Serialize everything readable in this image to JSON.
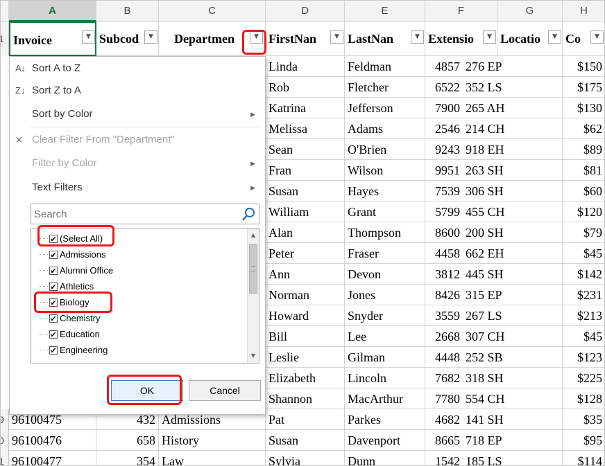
{
  "columns": [
    "A",
    "B",
    "C",
    "D",
    "E",
    "F",
    "G",
    "H"
  ],
  "header_row_number": "1",
  "headers": [
    "Invoice",
    "Subcod",
    "Departmen",
    "FirstNan",
    "LastNan",
    "Extensio",
    "Locatio",
    "Co"
  ],
  "rows": [
    {
      "first": "Linda",
      "last": "Feldman",
      "ext": "4857",
      "loc": "276 EP",
      "cost": "$150"
    },
    {
      "first": "Rob",
      "last": "Fletcher",
      "ext": "6522",
      "loc": "352 LS",
      "cost": "$175"
    },
    {
      "first": "Katrina",
      "last": "Jefferson",
      "ext": "7900",
      "loc": "265 AH",
      "cost": "$130"
    },
    {
      "first": "Melissa",
      "last": "Adams",
      "ext": "2546",
      "loc": "214 CH",
      "cost": "$62"
    },
    {
      "first": "Sean",
      "last": "O'Brien",
      "ext": "9243",
      "loc": "918 EH",
      "cost": "$89"
    },
    {
      "first": "Fran",
      "last": "Wilson",
      "ext": "9951",
      "loc": "263 SH",
      "cost": "$81"
    },
    {
      "first": "Susan",
      "last": "Hayes",
      "ext": "7539",
      "loc": "306 SH",
      "cost": "$60"
    },
    {
      "first": "William",
      "last": "Grant",
      "ext": "5799",
      "loc": "455 CH",
      "cost": "$120"
    },
    {
      "first": "Alan",
      "last": "Thompson",
      "ext": "8600",
      "loc": "200 SH",
      "cost": "$79"
    },
    {
      "first": "Peter",
      "last": "Fraser",
      "ext": "4458",
      "loc": "662 EH",
      "cost": "$45"
    },
    {
      "first": "Ann",
      "last": "Devon",
      "ext": "3812",
      "loc": "445 SH",
      "cost": "$142"
    },
    {
      "first": "Norman",
      "last": "Jones",
      "ext": "8426",
      "loc": "315 EP",
      "cost": "$231"
    },
    {
      "first": "Howard",
      "last": "Snyder",
      "ext": "3559",
      "loc": "267 LS",
      "cost": "$213"
    },
    {
      "first": "Bill",
      "last": "Lee",
      "ext": "2668",
      "loc": "307 CH",
      "cost": "$45"
    },
    {
      "first": "Leslie",
      "last": "Gilman",
      "ext": "4448",
      "loc": "252 SB",
      "cost": "$123"
    },
    {
      "first": "Elizabeth",
      "last": "Lincoln",
      "ext": "7682",
      "loc": "318 SH",
      "cost": "$225"
    },
    {
      "first": "Shannon",
      "last": "MacArthur",
      "ext": "7780",
      "loc": "554 CH",
      "cost": "$128"
    },
    {
      "rownum": "9",
      "invoice": "96100475",
      "subcode": "432",
      "dept": "Admissions",
      "first": "Pat",
      "last": "Parkes",
      "ext": "4682",
      "loc": "141 SH",
      "cost": "$35"
    },
    {
      "rownum": "0",
      "invoice": "96100476",
      "subcode": "658",
      "dept": "History",
      "first": "Susan",
      "last": "Davenport",
      "ext": "8665",
      "loc": "718 EP",
      "cost": "$95"
    },
    {
      "rownum": "1",
      "invoice": "96100477",
      "subcode": "354",
      "dept": "Law",
      "first": "Sylvia",
      "last": "Dunn",
      "ext": "1542",
      "loc": "185 LS",
      "cost": "$114"
    }
  ],
  "filter_menu": {
    "sort_az": "Sort A to Z",
    "sort_za": "Sort Z to A",
    "sort_by_color": "Sort by Color",
    "clear_filter": "Clear Filter From \"Department\"",
    "filter_by_color": "Filter by Color",
    "text_filters": "Text Filters",
    "search_placeholder": "Search",
    "items": [
      {
        "label": "(Select All)",
        "checked": true
      },
      {
        "label": "Admissions",
        "checked": true
      },
      {
        "label": "Alumni Office",
        "checked": true
      },
      {
        "label": "Athletics",
        "checked": true
      },
      {
        "label": "Biology",
        "checked": true
      },
      {
        "label": "Chemistry",
        "checked": true
      },
      {
        "label": "Education",
        "checked": true
      },
      {
        "label": "Engineering",
        "checked": true
      }
    ],
    "ok_label": "OK",
    "cancel_label": "Cancel"
  },
  "colors": {
    "highlight": "#e8181c",
    "excel_green": "#217346"
  }
}
